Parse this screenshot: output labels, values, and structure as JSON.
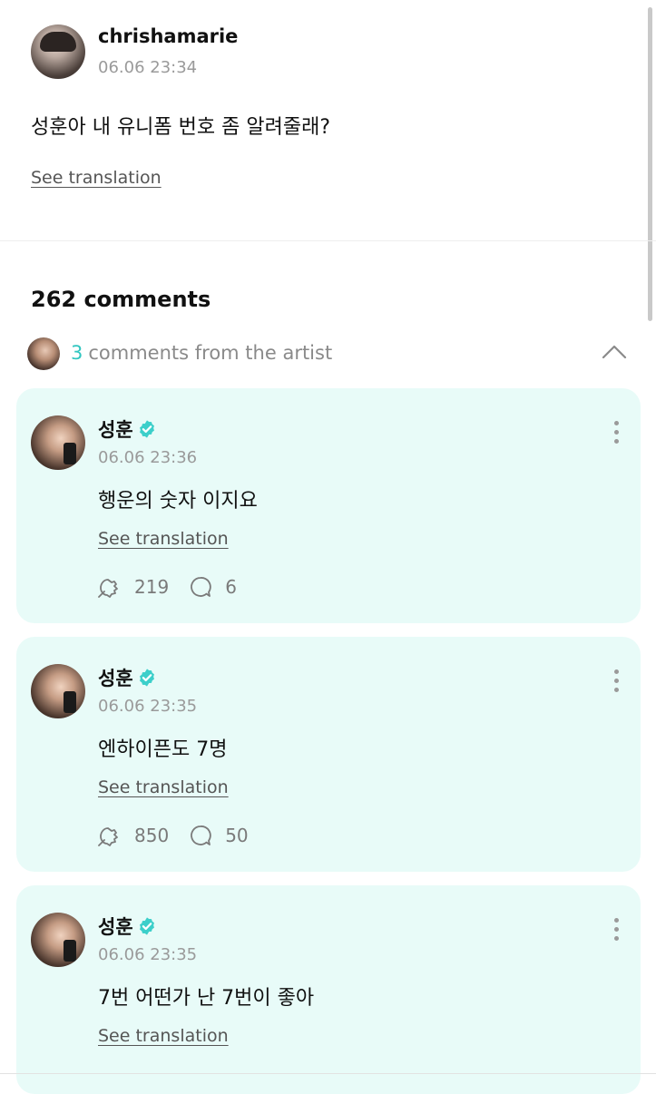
{
  "post": {
    "username": "chrishamarie",
    "time": "06.06 23:34",
    "body": "성훈아 내 유니폼 번호 좀 알려줄래?",
    "translate_label": "See translation"
  },
  "comments_header": {
    "count_label": "262 comments",
    "artist_count": "3",
    "artist_label": "comments from the artist"
  },
  "comments": [
    {
      "name": "성훈",
      "time": "06.06 23:36",
      "body": "행운의 숫자 이지요",
      "translate_label": "See translation",
      "likes": "219",
      "replies": "6"
    },
    {
      "name": "성훈",
      "time": "06.06 23:35",
      "body": "엔하이픈도 7명",
      "translate_label": "See translation",
      "likes": "850",
      "replies": "50"
    },
    {
      "name": "성훈",
      "time": "06.06 23:35",
      "body": "7번 어떤가 난 7번이 좋아",
      "translate_label": "See translation",
      "likes": "",
      "replies": ""
    }
  ],
  "colors": {
    "card_bg": "#e8fbf8",
    "accent": "#31c6c0",
    "verified": "#3ccfca"
  }
}
